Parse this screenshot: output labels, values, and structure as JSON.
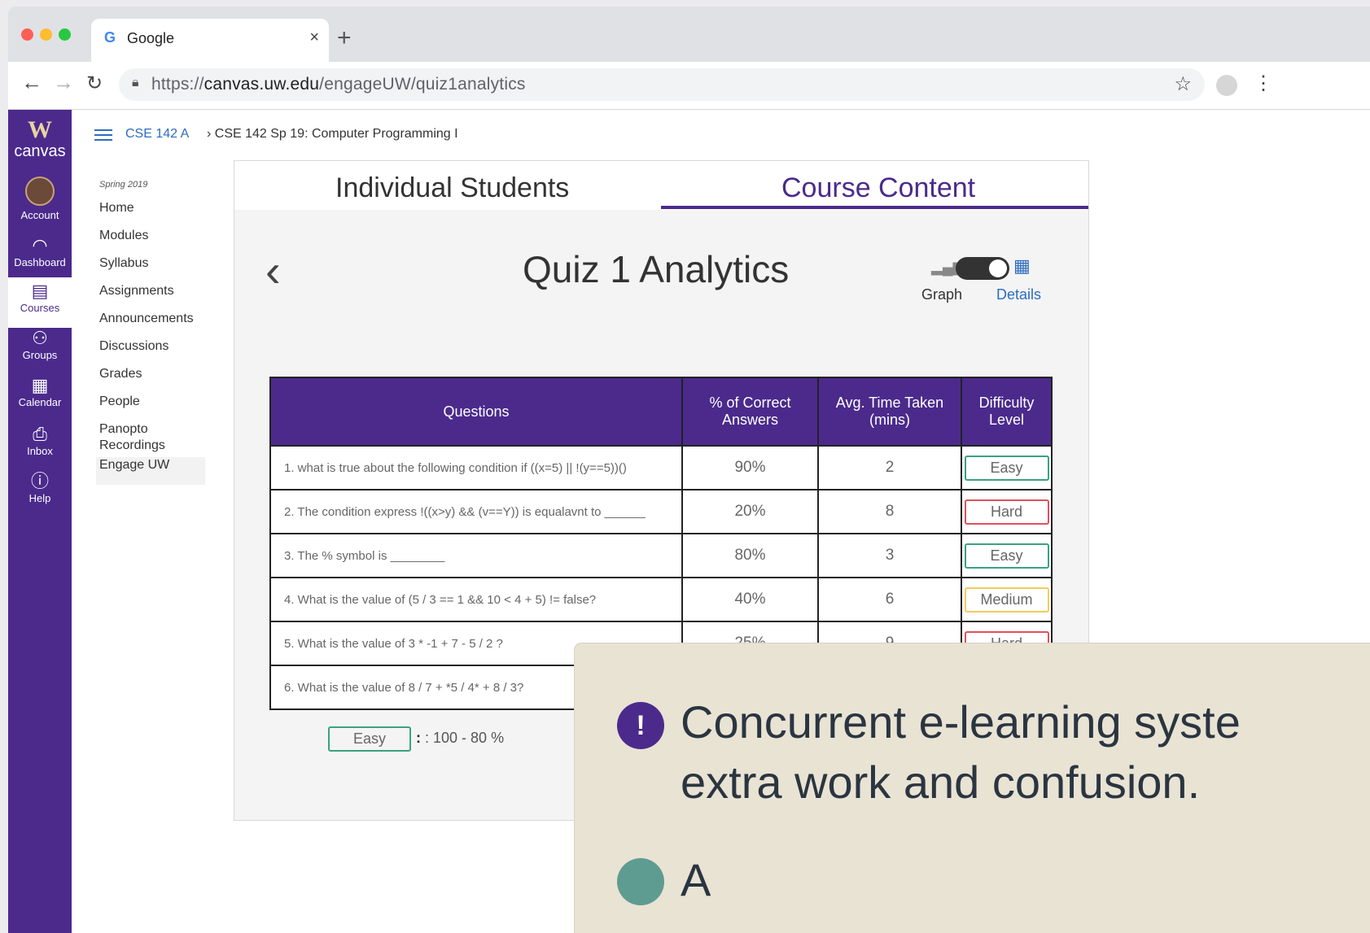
{
  "browser": {
    "tab_title": "Google",
    "tab_icon": "G",
    "url_prefix": "https://",
    "url_host": "canvas.uw.edu",
    "url_path": "/engageUW/quiz1analytics"
  },
  "global_nav": {
    "logo_w": "W",
    "logo_text": "canvas",
    "items": [
      {
        "label": "Account",
        "icon": "avatar"
      },
      {
        "label": "Dashboard",
        "icon": "dashboard-icon"
      },
      {
        "label": "Courses",
        "icon": "book-icon"
      },
      {
        "label": "Groups",
        "icon": "groups-icon"
      },
      {
        "label": "Calendar",
        "icon": "calendar-icon"
      },
      {
        "label": "Inbox",
        "icon": "inbox-icon"
      },
      {
        "label": "Help",
        "icon": "help-icon"
      }
    ],
    "accent": "#4b2a8c"
  },
  "breadcrumb": {
    "course": "CSE 142 A",
    "current": "› CSE 142 Sp 19: Computer Programming I"
  },
  "course_nav": {
    "term": "Spring 2019",
    "items": [
      "Home",
      "Modules",
      "Syllabus",
      "Assignments",
      "Announcements",
      "Discussions",
      "Grades",
      "People",
      "Panopto Recordings",
      "Engage UW"
    ]
  },
  "panel": {
    "tabs": [
      "Individual Students",
      "Course Content"
    ],
    "active_tab": "Course Content",
    "title": "Quiz 1 Analytics",
    "toggle": {
      "left": "Graph",
      "right": "Details"
    }
  },
  "table": {
    "headers": [
      "Questions",
      "% of Correct Answers",
      "Avg. Time Taken (mins)",
      "Difficulty Level"
    ],
    "rows": [
      {
        "q": "1. what is true about the following condition  if ((x=5) || !(y==5))()",
        "pct": "90%",
        "time": "2",
        "level": "Easy"
      },
      {
        "q": "2. The condition express !((x>y) && (v==Y)) is equalavnt to ______",
        "pct": "20%",
        "time": "8",
        "level": "Hard"
      },
      {
        "q": "3. The %  symbol is ________",
        "pct": "80%",
        "time": "3",
        "level": "Easy"
      },
      {
        "q": "4. What is the value of (5 / 3 == 1 && 10 < 4 + 5) != false?",
        "pct": "40%",
        "time": "6",
        "level": "Medium"
      },
      {
        "q": "5. What is the value of 3 * -1 + 7 - 5 / 2 ?",
        "pct": "25%",
        "time": "9",
        "level": "Hard"
      },
      {
        "q": "6. What is the value of 8 / 7 + *5 / 4* + 8 / 3?",
        "pct": "",
        "time": "",
        "level": ""
      }
    ]
  },
  "legend": {
    "label": "Easy",
    "range": ": 100 - 80 %"
  },
  "callout": {
    "line1": "Concurrent e-learning syste",
    "line2": "extra work and confusion.",
    "line3": "A"
  }
}
